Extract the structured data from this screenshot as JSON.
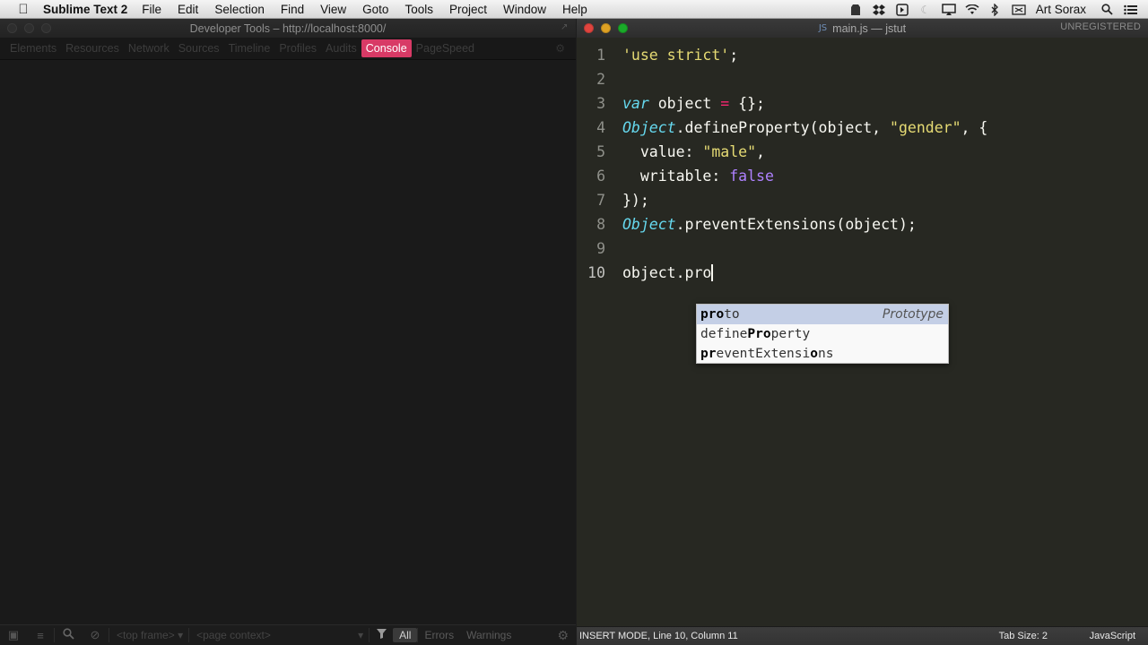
{
  "menubar": {
    "app_name": "Sublime Text 2",
    "items": [
      "File",
      "Edit",
      "Selection",
      "Find",
      "View",
      "Goto",
      "Tools",
      "Project",
      "Window",
      "Help"
    ],
    "user_name": "Art Sorax",
    "status_icons": [
      "evernote-icon",
      "dropbox-icon",
      "display-icon",
      "moon-icon",
      "airplay-icon",
      "wifi-icon",
      "bluetooth-icon",
      "keyboard-icon"
    ]
  },
  "devtools": {
    "title": "Developer Tools – http://localhost:8000/",
    "tabs": [
      "Elements",
      "Resources",
      "Network",
      "Sources",
      "Timeline",
      "Profiles",
      "Audits",
      "Console",
      "PageSpeed"
    ],
    "active_tab": "Console",
    "status": {
      "frame": "<top frame>",
      "context": "<page context>",
      "filters": [
        "All",
        "Errors",
        "Warnings"
      ],
      "active_filter": "All"
    }
  },
  "sublime": {
    "file_name": "main.js",
    "project_name": "jstut",
    "title_separator": " — ",
    "unregistered": "UNREGISTERED",
    "lines": [
      {
        "num": "1",
        "tokens": [
          {
            "t": "'use strict'",
            "c": "string"
          },
          {
            "t": ";",
            "c": "plain"
          }
        ]
      },
      {
        "num": "2",
        "tokens": []
      },
      {
        "num": "3",
        "tokens": [
          {
            "t": "var",
            "c": "keyword-italic"
          },
          {
            "t": " object ",
            "c": "plain"
          },
          {
            "t": "=",
            "c": "operator"
          },
          {
            "t": " {};",
            "c": "plain"
          }
        ]
      },
      {
        "num": "4",
        "tokens": [
          {
            "t": "Object",
            "c": "class-italic"
          },
          {
            "t": ".defineProperty(object, ",
            "c": "plain"
          },
          {
            "t": "\"gender\"",
            "c": "string"
          },
          {
            "t": ", {",
            "c": "plain"
          }
        ]
      },
      {
        "num": "5",
        "tokens": [
          {
            "t": "  ",
            "c": "ws"
          },
          {
            "t": "value: ",
            "c": "plain"
          },
          {
            "t": "\"male\"",
            "c": "string"
          },
          {
            "t": ",",
            "c": "plain"
          }
        ]
      },
      {
        "num": "6",
        "tokens": [
          {
            "t": "  ",
            "c": "ws"
          },
          {
            "t": "writable: ",
            "c": "plain"
          },
          {
            "t": "false",
            "c": "constant"
          }
        ]
      },
      {
        "num": "7",
        "tokens": [
          {
            "t": "});",
            "c": "plain"
          }
        ]
      },
      {
        "num": "8",
        "tokens": [
          {
            "t": "Object",
            "c": "class-italic"
          },
          {
            "t": ".preventExtensions(object);",
            "c": "plain"
          }
        ]
      },
      {
        "num": "9",
        "tokens": []
      },
      {
        "num": "10",
        "tokens": [
          {
            "t": "object.pro",
            "c": "plain"
          }
        ],
        "cursor": true,
        "current": true
      }
    ],
    "autocomplete": [
      {
        "parts": [
          {
            "t": "pro",
            "m": true
          },
          {
            "t": "to",
            "m": false
          }
        ],
        "hint": "Prototype",
        "selected": true
      },
      {
        "parts": [
          {
            "t": "define",
            "m": false
          },
          {
            "t": "Pro",
            "m": true
          },
          {
            "t": "perty",
            "m": false
          }
        ],
        "hint": "",
        "selected": false
      },
      {
        "parts": [
          {
            "t": "pr",
            "m": true
          },
          {
            "t": "eventExtensi",
            "m": false
          },
          {
            "t": "o",
            "m": true
          },
          {
            "t": "ns",
            "m": false
          }
        ],
        "hint": "",
        "selected": false
      }
    ],
    "status": {
      "mode": "INSERT MODE, Line 10, Column 11",
      "tab_size": "Tab Size: 2",
      "syntax": "JavaScript"
    }
  }
}
